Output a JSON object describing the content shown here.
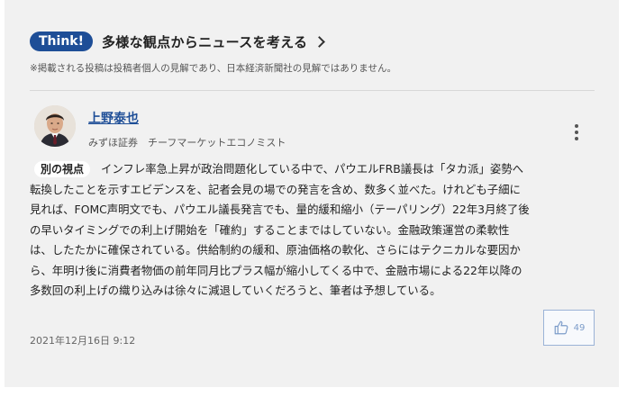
{
  "think": {
    "badge": "Think!",
    "title": "多様な観点からニュースを考える",
    "disclaimer": "※掲載される投稿は投稿者個人の見解であり、日本経済新聞社の見解ではありません。"
  },
  "comment": {
    "author_name": "上野泰也",
    "author_title": "みずほ証券　チーフマーケットエコノミスト",
    "view_label": "別の視点",
    "body_lines": [
      "インフレ率急上昇が政治問題化している中で、パウエルFRB議長は「タカ派」姿勢へ",
      "転換したことを示すエビデンスを、記者会見の場での発言を含め、数多く並べた。けれども子細に",
      "見れば、FOMC声明文でも、パウエル議長発言でも、量的緩和縮小（テーパリング）22年3月終了後",
      "の早いタイミングでの利上げ開始を「確約」することまではしていない。金融政策運営の柔軟性",
      "は、したたかに確保されている。供給制約の緩和、原油価格の軟化、さらにはテクニカルな要因か",
      "ら、年明け後に消費者物価の前年同月比プラス幅が縮小してくる中で、金融市場による22年以降の",
      "多数回の利上げの織り込みは徐々に減退していくだろうと、筆者は予想している。"
    ],
    "timestamp": "2021年12月16日 9:12",
    "like_count": "49"
  },
  "colors": {
    "accent": "#1e4e97",
    "card_bg": "#f1f1f1",
    "like_border": "#9bb3d7"
  }
}
